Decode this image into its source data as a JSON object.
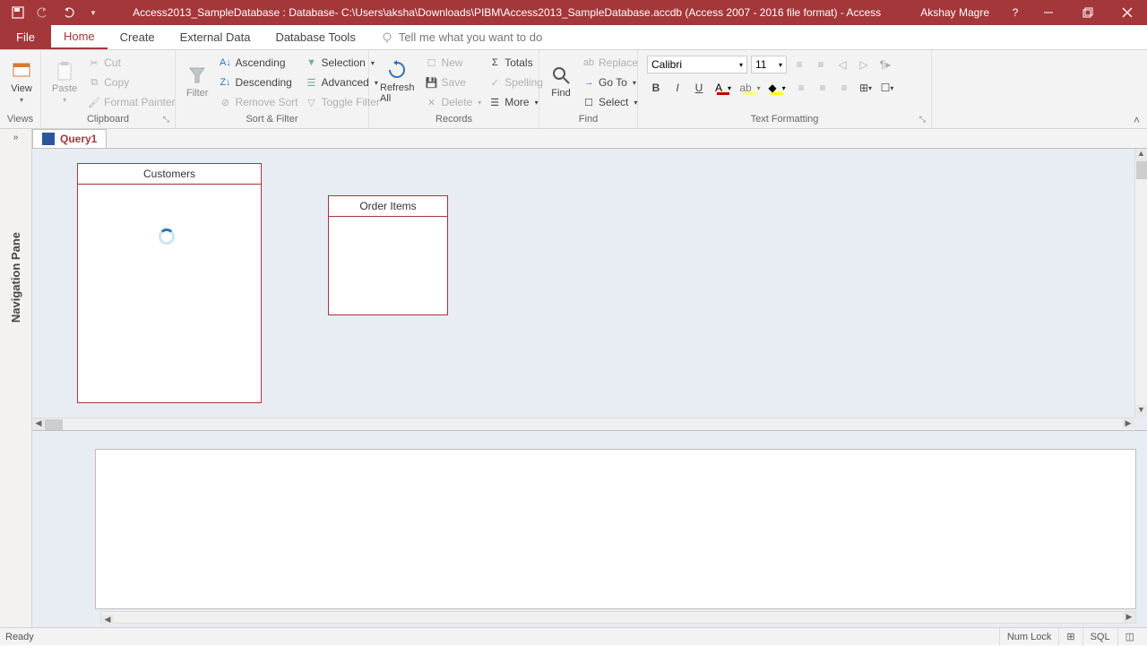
{
  "titlebar": {
    "title": "Access2013_SampleDatabase : Database- C:\\Users\\aksha\\Downloads\\PIBM\\Access2013_SampleDatabase.accdb (Access 2007 - 2016 file format)  -  Access",
    "user": "Akshay Magre"
  },
  "tabs": {
    "file": "File",
    "home": "Home",
    "create": "Create",
    "external_data": "External Data",
    "database_tools": "Database Tools",
    "tell_me": "Tell me what you want to do"
  },
  "ribbon": {
    "views": {
      "view": "View",
      "group": "Views"
    },
    "clipboard": {
      "paste": "Paste",
      "cut": "Cut",
      "copy": "Copy",
      "format_painter": "Format Painter",
      "group": "Clipboard"
    },
    "sort_filter": {
      "filter": "Filter",
      "ascending": "Ascending",
      "descending": "Descending",
      "remove_sort": "Remove Sort",
      "selection": "Selection",
      "advanced": "Advanced",
      "toggle_filter": "Toggle Filter",
      "group": "Sort & Filter"
    },
    "records": {
      "refresh": "Refresh\nAll",
      "new": "New",
      "save": "Save",
      "delete": "Delete",
      "totals": "Totals",
      "spelling": "Spelling",
      "more": "More",
      "group": "Records"
    },
    "find": {
      "find": "Find",
      "replace": "Replace",
      "goto": "Go To",
      "select": "Select",
      "group": "Find"
    },
    "text": {
      "font": "Calibri",
      "size": "11",
      "group": "Text Formatting"
    }
  },
  "nav_pane": {
    "label": "Navigation Pane"
  },
  "doc_tab": {
    "name": "Query1"
  },
  "tables": {
    "customers": "Customers",
    "order_items": "Order Items"
  },
  "statusbar": {
    "ready": "Ready",
    "numlock": "Num Lock"
  }
}
